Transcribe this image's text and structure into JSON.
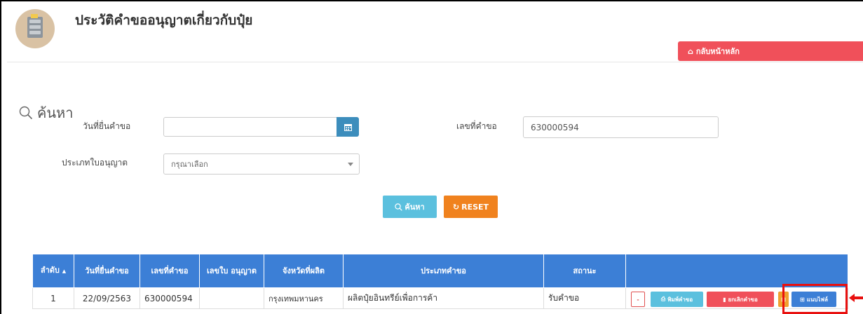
{
  "header": {
    "title": "ประวัติคำขออนุญาตเกี่ยวกับปุ๋ย",
    "home_button": "กลับหน้าหลัก"
  },
  "search": {
    "heading": "ค้นหา",
    "date_label": "วันที่ยื่นคำขอ",
    "date_value": "",
    "request_no_label": "เลขที่คำขอ",
    "request_no_value": "630000594",
    "license_type_label": "ประเภทใบอนุญาต",
    "license_type_placeholder": "กรุณาเลือก",
    "search_button": "ค้นหา",
    "reset_button": "RESET"
  },
  "table": {
    "headers": [
      "ลำดับ",
      "วันที่ยื่นคำขอ",
      "เลขที่คำขอ",
      "เลขใบ อนุญาต",
      "จังหวัดที่ผลิต",
      "ประเภทคำขอ",
      "สถานะ",
      ""
    ],
    "sort_indicator": "▲",
    "rows": [
      {
        "no": "1",
        "date": "22/09/2563",
        "request_no": "630000594",
        "license_no": "",
        "province": "กรุงเทพมหานคร",
        "request_type": "ผลิตปุ๋ยอินทรีย์เพื่อการค้า",
        "status": "รับคำขอ",
        "actions": {
          "detail": "-",
          "print": "พิมพ์คำขอ",
          "cancel": "ยกเลิกคำขอ",
          "attach": "แนบไฟล์"
        }
      }
    ]
  },
  "colors": {
    "table_header": "#3c7fd6",
    "home_button": "#f0505a",
    "search_button": "#5bc0de",
    "reset_button": "#f0821e",
    "cancel_button": "#f0505a",
    "attach_button": "#3c7fd6",
    "highlight": "#e8100f"
  }
}
